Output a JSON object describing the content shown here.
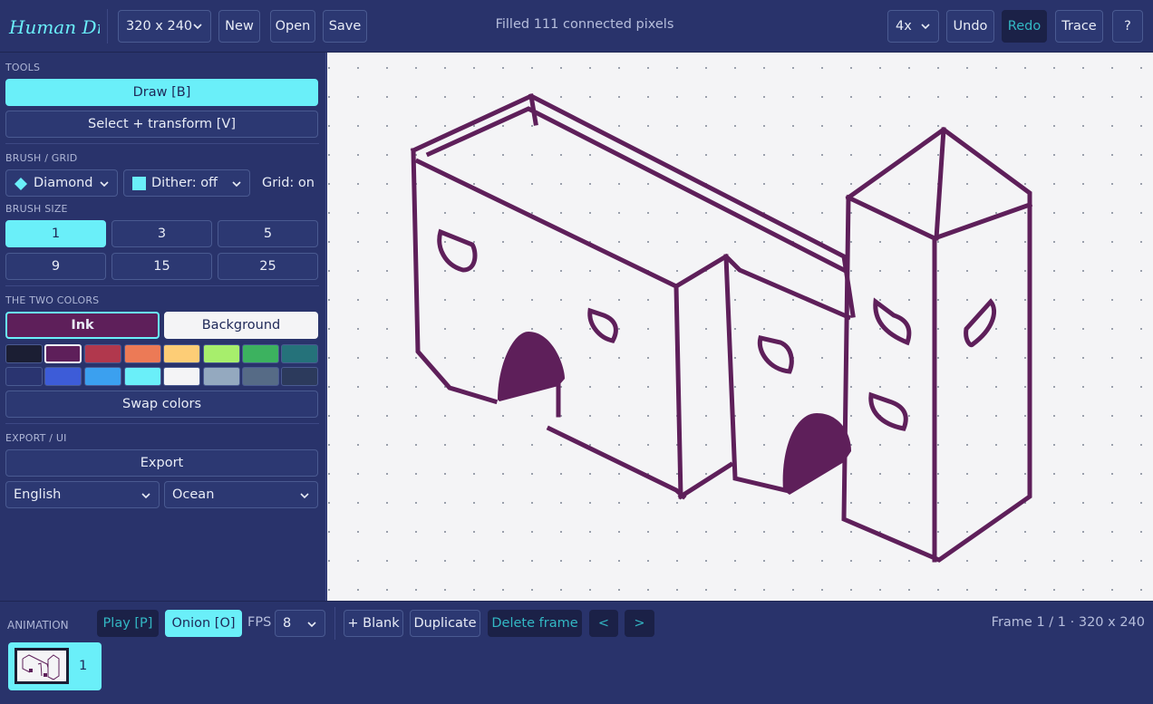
{
  "app": {
    "logo_text": "Human Draw",
    "status": "Filled 111 connected pixels"
  },
  "toolbar": {
    "canvas_size": "320 x 240",
    "new_label": "New",
    "open_label": "Open",
    "save_label": "Save",
    "zoom": "4x",
    "undo_label": "Undo",
    "redo_label": "Redo",
    "trace_label": "Trace",
    "help_label": "?"
  },
  "sidebar": {
    "tools_heading": "TOOLS",
    "tools": [
      {
        "label": "Draw  [B]",
        "active": true
      },
      {
        "label": "Select + transform  [V]",
        "active": false
      }
    ],
    "brush_grid_heading": "BRUSH / GRID",
    "brush_shape": "Diamond",
    "dither": "Dither: off",
    "grid": "Grid: on",
    "brush_size_heading": "BRUSH SIZE",
    "brush_sizes": [
      "1",
      "3",
      "5",
      "9",
      "15",
      "25"
    ],
    "selected_brush_size": "1",
    "colors_heading": "THE TWO COLORS",
    "ink_label": "Ink",
    "background_label": "Background",
    "ink_color": "#5e1f5a",
    "background_color": "#f4f4f6",
    "palette": [
      "#1b1e33",
      "#5e1f5a",
      "#b1384d",
      "#ec7a56",
      "#fdcd76",
      "#a7ee6c",
      "#3cb25f",
      "#25727a",
      "#2a3470",
      "#3d5cd8",
      "#3ba0ef",
      "#6aeff9",
      "#f4f4f6",
      "#94a9bf",
      "#566b86",
      "#2c3a5c"
    ],
    "swap_label": "Swap colors",
    "export_heading": "EXPORT / UI",
    "export_label": "Export",
    "language": "English",
    "theme": "Ocean"
  },
  "animation": {
    "heading": "ANIMATION",
    "play_label": "Play  [P]",
    "onion_label": "Onion  [O]",
    "fps_label": "FPS",
    "fps_value": "8",
    "blank_label": "+ Blank",
    "duplicate_label": "Duplicate",
    "delete_label": "Delete frame",
    "prev_label": "<",
    "next_label": ">",
    "frame_info": "Frame 1 / 1  ·  320 x 240",
    "frames": [
      {
        "number": "1"
      }
    ]
  },
  "colors": {
    "accent": "#6aeff9",
    "panel": "#29336b",
    "ink": "#5e1f5a"
  }
}
